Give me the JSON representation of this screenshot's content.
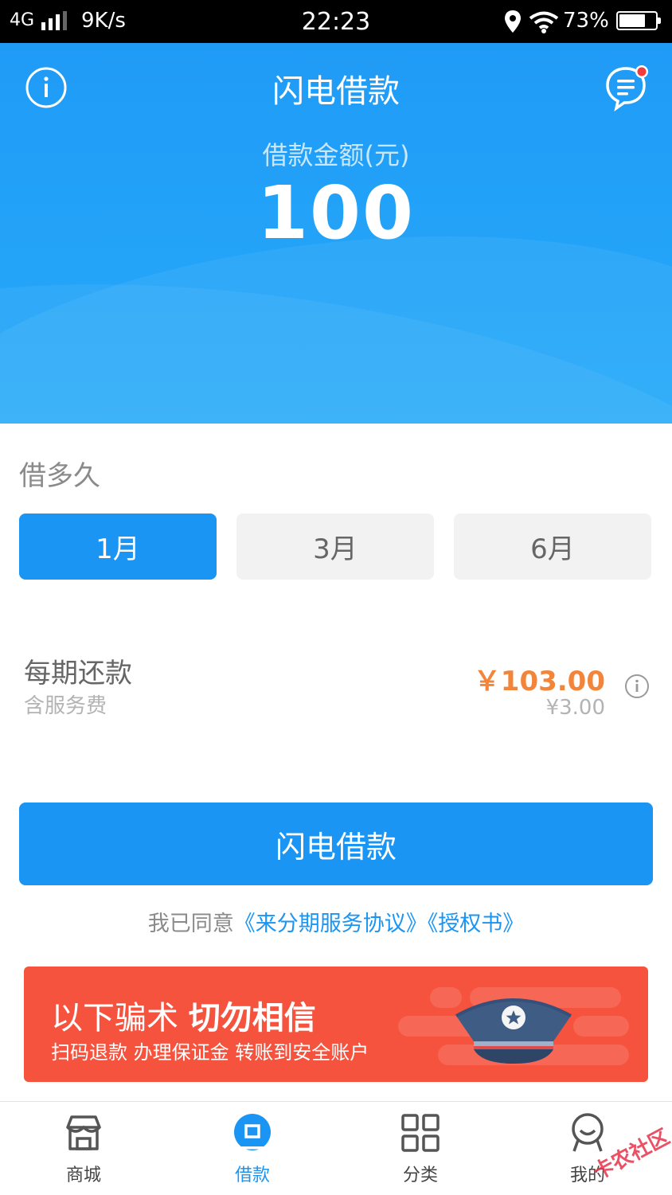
{
  "status_bar": {
    "network": "4G",
    "speed": "9K/s",
    "time": "22:23",
    "battery": "73%",
    "battery_level": 0.73
  },
  "header": {
    "title": "闪电借款",
    "amount_label": "借款金额(元)",
    "amount": "100"
  },
  "duration": {
    "title": "借多久",
    "options": [
      {
        "label": "1月",
        "selected": true
      },
      {
        "label": "3月",
        "selected": false
      },
      {
        "label": "6月",
        "selected": false
      }
    ]
  },
  "repayment": {
    "title": "每期还款",
    "subtitle": "含服务费",
    "amount": "￥103.00",
    "fee": "¥3.00"
  },
  "submit": {
    "label": "闪电借款"
  },
  "agreement": {
    "prefix": "我已同意",
    "link1": "《来分期服务协议》",
    "link2": "《授权书》"
  },
  "banner": {
    "title_normal": "以下骗术",
    "title_bold": "切勿相信",
    "subtitle": "扫码退款 办理保证金 转账到安全账户"
  },
  "tabs": [
    {
      "label": "商城",
      "icon": "store-icon",
      "active": false
    },
    {
      "label": "借款",
      "icon": "loan-icon",
      "active": true
    },
    {
      "label": "分类",
      "icon": "grid-icon",
      "active": false
    },
    {
      "label": "我的",
      "icon": "profile-icon",
      "active": false
    }
  ],
  "watermark": "卡农社区",
  "colors": {
    "primary": "#1a95f4",
    "hero_gradient_top": "#1f9bf7",
    "price_orange": "#f2853a",
    "banner_red": "#f5533e"
  }
}
